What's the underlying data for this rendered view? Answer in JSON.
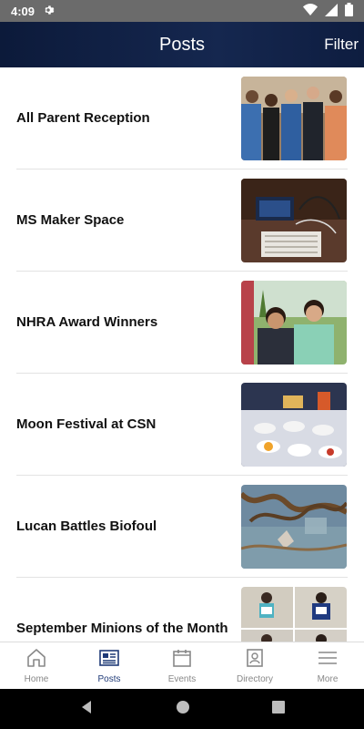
{
  "status_bar": {
    "time": "4:09"
  },
  "header": {
    "title": "Posts",
    "filter_label": "Filter"
  },
  "posts": [
    {
      "title": "All Parent Reception"
    },
    {
      "title": "MS Maker Space"
    },
    {
      "title": "NHRA Award Winners"
    },
    {
      "title": "Moon Festival at CSN"
    },
    {
      "title": "Lucan Battles Biofoul"
    },
    {
      "title": "September Minions of the Month"
    }
  ],
  "bottom_nav": {
    "home": "Home",
    "posts": "Posts",
    "events": "Events",
    "directory": "Directory",
    "more": "More"
  },
  "colors": {
    "header": "#0c1a3a",
    "active_tab": "#1f3a77",
    "inactive_tab": "#888888"
  }
}
